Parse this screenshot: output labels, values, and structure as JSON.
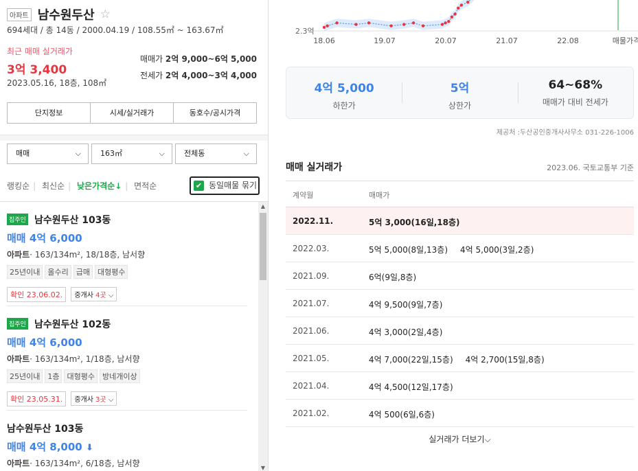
{
  "complex": {
    "type_tag": "아파트",
    "name": "남수원두산",
    "star": "☆",
    "meta": "694세대 / 총 14동 / 2000.04.19 / 108.55㎡ ~ 163.67㎡",
    "recent_label": "최근 매매 실거래가",
    "recent_price": "3억 3,400",
    "recent_date": "2023.05.16, 18층, 108㎡",
    "sale_range_label": "매매가",
    "sale_range": "2억 9,000~6억 5,000",
    "lease_range_label": "전세가",
    "lease_range": "2억 4,000~3억 4,000"
  },
  "info_tabs": [
    "단지정보",
    "시세/실거래가",
    "동호수/공시가격"
  ],
  "filters": {
    "trade_type": "매매",
    "area": "163㎡",
    "building": "전체동",
    "chevron": "⌵"
  },
  "sorts": {
    "items": [
      "랭킹순",
      "최신순",
      "낮은가격순↓",
      "면적순"
    ],
    "group_same": "동일매물 묶기"
  },
  "listings": [
    {
      "owner_tag": "집주인",
      "name": "남수원두산 103동",
      "price": "매매 4억 6,000",
      "price_arrow": "",
      "desc_type": "아파트",
      "desc": "163/134m², 18/18층, 남서향",
      "tags": [
        "25년이내",
        "올수리",
        "급매",
        "대형평수"
      ],
      "confirm": "확인 23.06.02.",
      "broker_label": "중개사",
      "broker_count": "4곳"
    },
    {
      "owner_tag": "집주인",
      "name": "남수원두산 102동",
      "price": "매매 4억 6,000",
      "price_arrow": "",
      "desc_type": "아파트",
      "desc": "163/134m², 1/18층, 남서향",
      "tags": [
        "25년이내",
        "1층",
        "대형평수",
        "방네개이상"
      ],
      "confirm": "확인 23.05.31.",
      "broker_label": "중개사",
      "broker_count": "3곳"
    },
    {
      "owner_tag": "",
      "name": "남수원두산 103동",
      "price": "매매 4억 8,000",
      "price_arrow": "⬇",
      "desc_type": "아파트",
      "desc": "163/134m², 6/18층, 남서향",
      "tags": [],
      "confirm": "",
      "broker_label": "",
      "broker_count": ""
    }
  ],
  "chart_data": {
    "type": "scatter",
    "x_ticks": [
      "18.06",
      "19.07",
      "20.07",
      "21.07",
      "22.08",
      "매물가격"
    ],
    "y_label_visible": "2.3억",
    "note": "cropped view of price history chart; only lower portion visible",
    "points": [
      [
        18.05,
        2.35
      ],
      [
        18.1,
        2.4
      ],
      [
        18.25,
        2.5
      ],
      [
        18.55,
        2.45
      ],
      [
        18.75,
        2.5
      ],
      [
        19.1,
        2.4
      ],
      [
        19.3,
        2.45
      ],
      [
        19.45,
        2.5
      ],
      [
        19.6,
        2.4
      ],
      [
        19.9,
        2.45
      ],
      [
        19.95,
        2.5
      ],
      [
        20.0,
        2.55
      ],
      [
        20.05,
        2.7
      ],
      [
        20.1,
        2.8
      ],
      [
        20.15,
        3.0
      ],
      [
        20.2,
        3.1
      ],
      [
        20.3,
        3.2
      ],
      [
        20.4,
        3.4
      ],
      [
        20.55,
        3.6
      ],
      [
        20.6,
        3.9
      ]
    ],
    "colors": {
      "points": "#e8353f",
      "band": "#cfe3fb",
      "line": "#3e84e6",
      "listing_line": "#1ea64a"
    }
  },
  "summary": [
    {
      "value": "4억 5,000",
      "label": "하한가",
      "color": "#3e84e6"
    },
    {
      "value": "5억",
      "label": "상한가",
      "color": "#3e84e6"
    },
    {
      "value": "64~68%",
      "label": "매매가 대비 전세가",
      "color": "#222222"
    }
  ],
  "provider": "제공처 :두산공인중개사사무소 031-226-1006",
  "deals": {
    "title": "매매 실거래가",
    "basis": "2023.06. 국토교통부 기준",
    "col_date": "계약월",
    "col_price": "매매가",
    "rows": [
      {
        "date": "2022.11.",
        "prices": [
          "5억 3,000(16일,18층)"
        ],
        "highlight": true
      },
      {
        "date": "2022.03.",
        "prices": [
          "5억 5,000(8일,13층)",
          "4억 5,000(3일,2층)"
        ],
        "highlight": false
      },
      {
        "date": "2021.09.",
        "prices": [
          "6억(9일,8층)"
        ],
        "highlight": false
      },
      {
        "date": "2021.07.",
        "prices": [
          "4억 9,500(9일,7층)"
        ],
        "highlight": false
      },
      {
        "date": "2021.06.",
        "prices": [
          "4억 3,000(2일,4층)"
        ],
        "highlight": false
      },
      {
        "date": "2021.05.",
        "prices": [
          "4억 7,000(22일,15층)",
          "4억 2,700(15일,8층)"
        ],
        "highlight": false
      },
      {
        "date": "2021.04.",
        "prices": [
          "4억 4,500(12일,17층)"
        ],
        "highlight": false
      },
      {
        "date": "2021.02.",
        "prices": [
          "4억 500(6일,6층)"
        ],
        "highlight": false
      }
    ],
    "more": "실거래가 더보기⌵"
  }
}
